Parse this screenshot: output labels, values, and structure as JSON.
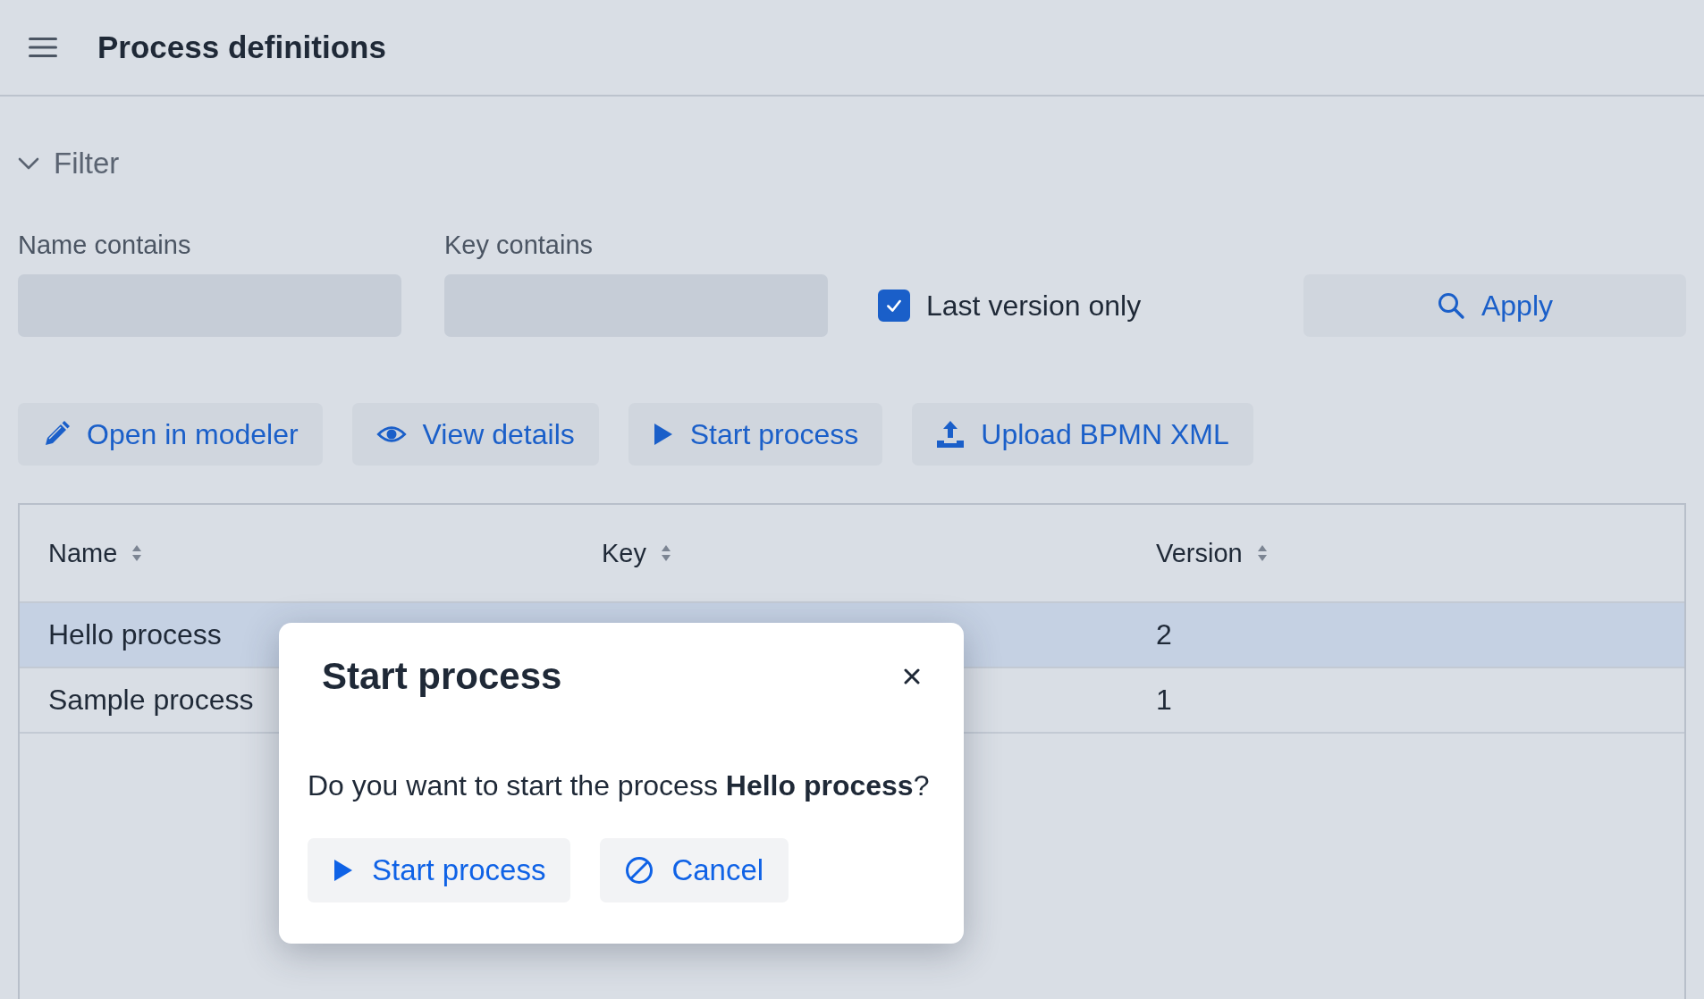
{
  "header": {
    "title": "Process definitions"
  },
  "filter": {
    "label": "Filter",
    "expanded": true,
    "fields": [
      {
        "label": "Name contains"
      },
      {
        "label": "Key contains"
      }
    ],
    "last_version_only": {
      "label": "Last version only",
      "checked": true
    },
    "apply_button": "Apply"
  },
  "toolbar": [
    {
      "label": "Open in modeler",
      "kind": "edit"
    },
    {
      "label": "View details",
      "kind": "view"
    },
    {
      "label": "Start process",
      "kind": "start"
    },
    {
      "label": "Upload BPMN XML",
      "kind": "upload"
    }
  ],
  "table": {
    "columns": [
      "Name",
      "Key",
      "Version"
    ],
    "rows": [
      {
        "name": "Hello process",
        "version": "2",
        "selected": true
      },
      {
        "name": "Sample process",
        "version": "1",
        "selected": false
      }
    ]
  },
  "dialog": {
    "title": "Start process",
    "message": "Do you want to start the process **Hello process**?",
    "buttons": [
      {
        "label": "Start process",
        "kind": "start"
      },
      {
        "label": "Cancel",
        "kind": "cancel"
      }
    ]
  }
}
